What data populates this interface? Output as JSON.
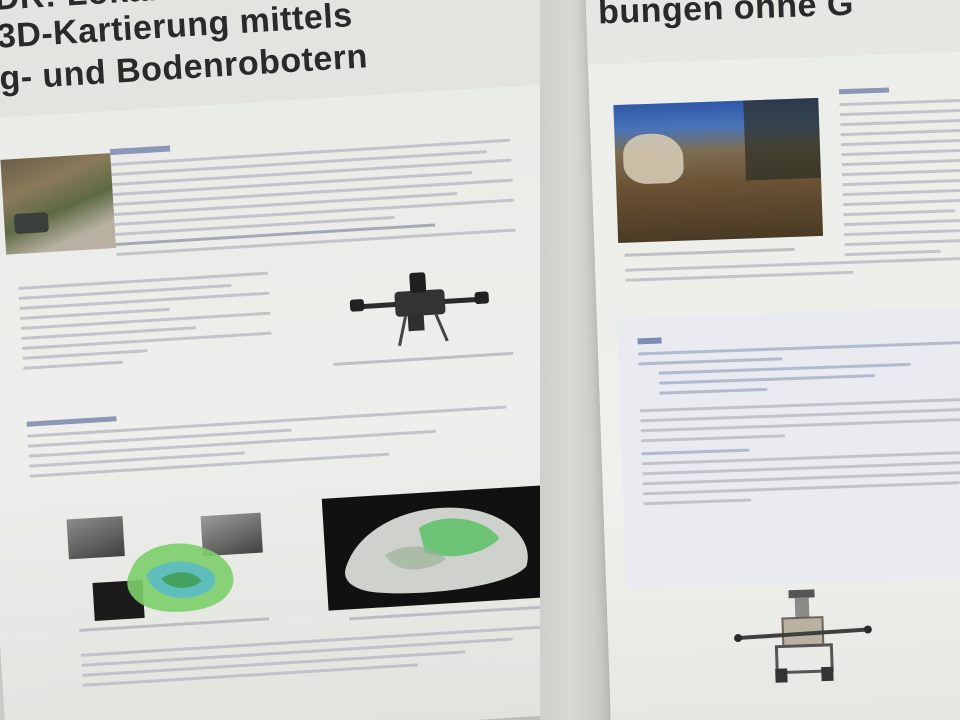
{
  "left_poster": {
    "title_lines": [
      "DR: Lokalisie",
      "3D-Kartierung mittels",
      "g- und Bodenrobotern"
    ]
  },
  "right_poster": {
    "title_fragment": "bungen ohne G"
  },
  "colors": {
    "background": "#cfd0cc",
    "poster_paper": "#ecedea",
    "title_text": "#2a2a2a",
    "body_text_blur": "#b4b6bd",
    "pointcloud_green": "#5fc46a",
    "photo_dark": "#1a1a1a"
  },
  "icons": [
    "quadcopter-drone",
    "ground-robot",
    "pointcloud-map"
  ]
}
